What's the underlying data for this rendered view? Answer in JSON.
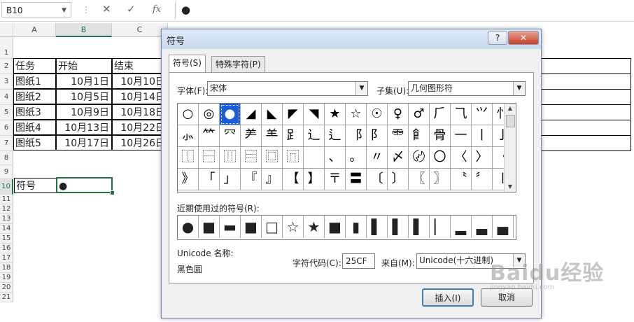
{
  "formula_bar": {
    "name_box": "B10",
    "separator": "⋮",
    "cancel": "✕",
    "enter": "✓",
    "fx": "fx",
    "content": "●"
  },
  "sheet": {
    "columns": [
      "A",
      "B",
      "C"
    ],
    "rows": [
      "1",
      "2",
      "3",
      "4",
      "5",
      "6",
      "7",
      "8",
      "9",
      "10",
      "11",
      "12",
      "13",
      "14",
      "15",
      "16",
      "17",
      "18",
      "19",
      "20",
      "21"
    ],
    "table": {
      "headers": [
        "任务",
        "开始",
        "结束"
      ],
      "rows": [
        [
          "图纸1",
          "10月1日",
          "10月10日"
        ],
        [
          "图纸2",
          "10月5日",
          "10月14日"
        ],
        [
          "图纸3",
          "10月9日",
          "10月18日"
        ],
        [
          "图纸4",
          "10月13日",
          "10月22日"
        ],
        [
          "图纸5",
          "10月17日",
          "10月26日"
        ]
      ]
    },
    "label_cell": "符号",
    "value_cell": "●"
  },
  "dialog": {
    "title": "符号",
    "help": "?",
    "close": "✕",
    "tabs": [
      "符号(S)",
      "特殊字符(P)"
    ],
    "font_label": "字体(F):",
    "font_value": "宋体",
    "subset_label": "子集(U):",
    "subset_value": "几何图形符",
    "symbols": [
      [
        "○",
        "◎",
        "●",
        "◢",
        "◣",
        "◤",
        "◥",
        "★",
        "☆",
        "☉",
        "♀",
        "♂",
        "⺁",
        "⺄",
        "⺍",
        "⺖"
      ],
      [
        "⺗",
        "⺮",
        "⺳",
        "⺶",
        "⺷",
        "⻊",
        "⻌",
        "⻍",
        "⻏",
        "⻖",
        "⻗",
        "⻞",
        "⻣",
        "⼀",
        "⼁",
        "⼅"
      ],
      [
        "⿰",
        "⿱",
        "⿲",
        "⿳",
        "⿴",
        "⿵",
        "　",
        "、",
        "。",
        "〃",
        "〆",
        "〄",
        "〇",
        "〈",
        "〉",
        "《"
      ],
      [
        "》",
        "「",
        "」",
        "『",
        "』",
        "【",
        "】",
        "〒",
        "〓",
        "〔",
        "〕",
        "〖",
        "〗",
        "〝",
        "〞",
        "〡"
      ]
    ],
    "selected_symbol_index": 2,
    "recent_label": "近期使用过的符号(R):",
    "recent": [
      "●",
      "■",
      "▬",
      "■",
      "□",
      "☆",
      "★",
      "■",
      "▮",
      "▌",
      "▌",
      "▌",
      "▏",
      "▂",
      "▃",
      "▄"
    ],
    "unicode_name_label": "Unicode 名称:",
    "unicode_name": "黑色圆",
    "char_code_label": "字符代码(C):",
    "char_code": "25CF",
    "from_label": "来自(M):",
    "from_value": "Unicode(十六进制)",
    "insert_button": "插入(I)",
    "cancel_button": "取消"
  },
  "watermark": {
    "text": "Baidu经验",
    "url": "jingyan.baidu.com"
  }
}
